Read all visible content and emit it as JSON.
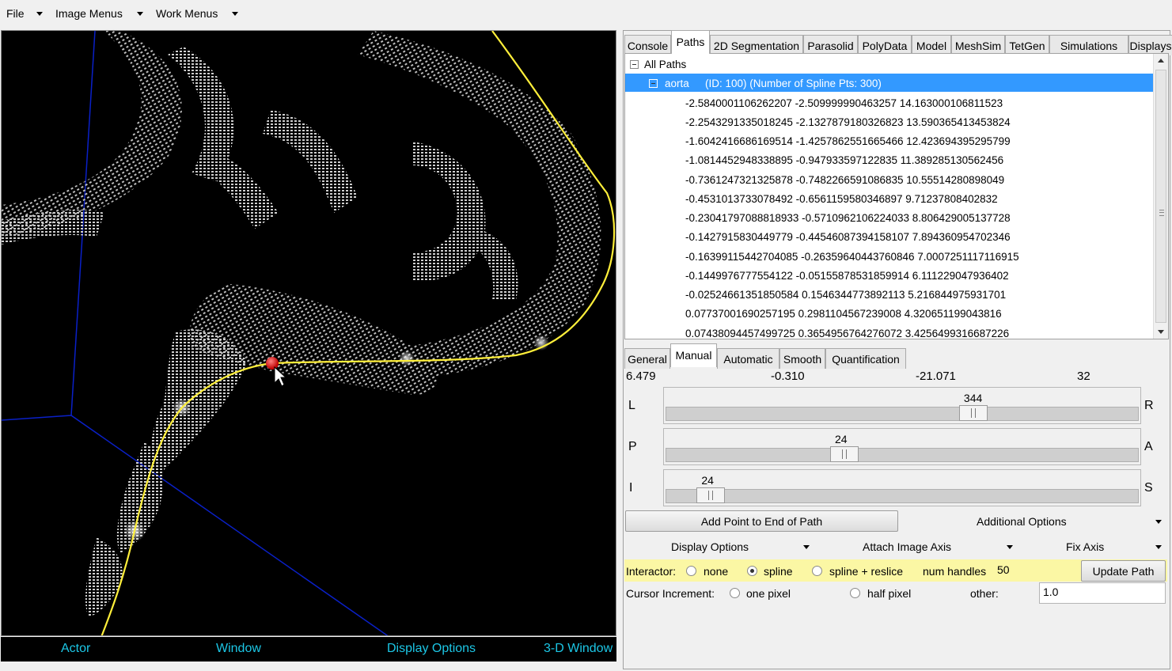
{
  "menubar": [
    {
      "label": "File"
    },
    {
      "label": "Image Menus"
    },
    {
      "label": "Work Menus"
    }
  ],
  "statusbar": {
    "actor": "Actor",
    "window": "Window",
    "display_options": "Display Options",
    "window3d": "3-D Window"
  },
  "top_tabs": [
    "Console",
    "Paths",
    "2D Segmentation",
    "Parasolid",
    "PolyData",
    "Model",
    "MeshSim",
    "TetGen",
    "Simulations",
    "Displays"
  ],
  "top_tabs_active": "Paths",
  "tree": {
    "root": "All Paths",
    "selected": {
      "name": "aorta",
      "info": "(ID: 100)  (Number of Spline Pts: 300)"
    },
    "points": [
      "-2.5840001106262207 -2.509999990463257 14.163000106811523",
      "-2.2543291335018245 -2.1327879180326823 13.590365413453824",
      "-1.6042416686169514 -1.4257862551665466 12.423694395295799",
      "-1.0814452948338895 -0.947933597122835 11.389285130562456",
      "-0.7361247321325878 -0.7482266591086835 10.55514280898049",
      "-0.4531013733078492 -0.6561159580346897 9.71237808402832",
      "-0.23041797088818933 -0.5710962106224033 8.806429005137728",
      "-0.1427915830449779 -0.44546087394158107 7.894360954702346",
      "-0.16399115442704085 -0.26359640443760846 7.0007251117116915",
      "-0.1449976777554122 -0.05155878531859914 6.111229047936402",
      "-0.02524661351850584 0.1546344773892113 5.216844975931701",
      "0.07737001690257195 0.2981104567239008 4.320651199043816",
      "0.07438094457499725 0.3654956764276072 3.4256499316687226"
    ]
  },
  "mid_tabs": [
    "General",
    "Manual",
    "Automatic",
    "Smooth",
    "Quantification"
  ],
  "mid_tabs_active": "Manual",
  "coords": [
    "6.479",
    "-0.310",
    "-21.071",
    "32"
  ],
  "sliders": [
    {
      "left": "L",
      "right": "R",
      "value": "344",
      "fraction": 0.66
    },
    {
      "left": "P",
      "right": "A",
      "value": "24",
      "fraction": 0.37
    },
    {
      "left": "I",
      "right": "S",
      "value": "24",
      "fraction": 0.07
    }
  ],
  "buttons": {
    "add_point": "Add Point to End of Path",
    "update_path": "Update Path"
  },
  "dropdowns": {
    "additional_options": "Additional Options",
    "display_options": "Display Options",
    "attach_image_axis": "Attach Image Axis",
    "fix_axis": "Fix Axis"
  },
  "interactor": {
    "label": "Interactor:",
    "options": [
      "none",
      "spline",
      "spline + reslice"
    ],
    "selected": "spline",
    "num_handles_label": "num handles",
    "num_handles": "50"
  },
  "cursor": {
    "label": "Cursor Increment:",
    "options": [
      "one pixel",
      "half pixel"
    ],
    "other_label": "other:",
    "other_value": "1.0"
  },
  "colors": {
    "path_line": "#ffef3a",
    "selection": "#3399ff",
    "status_text": "#1cc7e6",
    "interactor_bg": "#fbf7a4",
    "axis_lines": "#0a20c8",
    "control_point": "#e01010"
  }
}
